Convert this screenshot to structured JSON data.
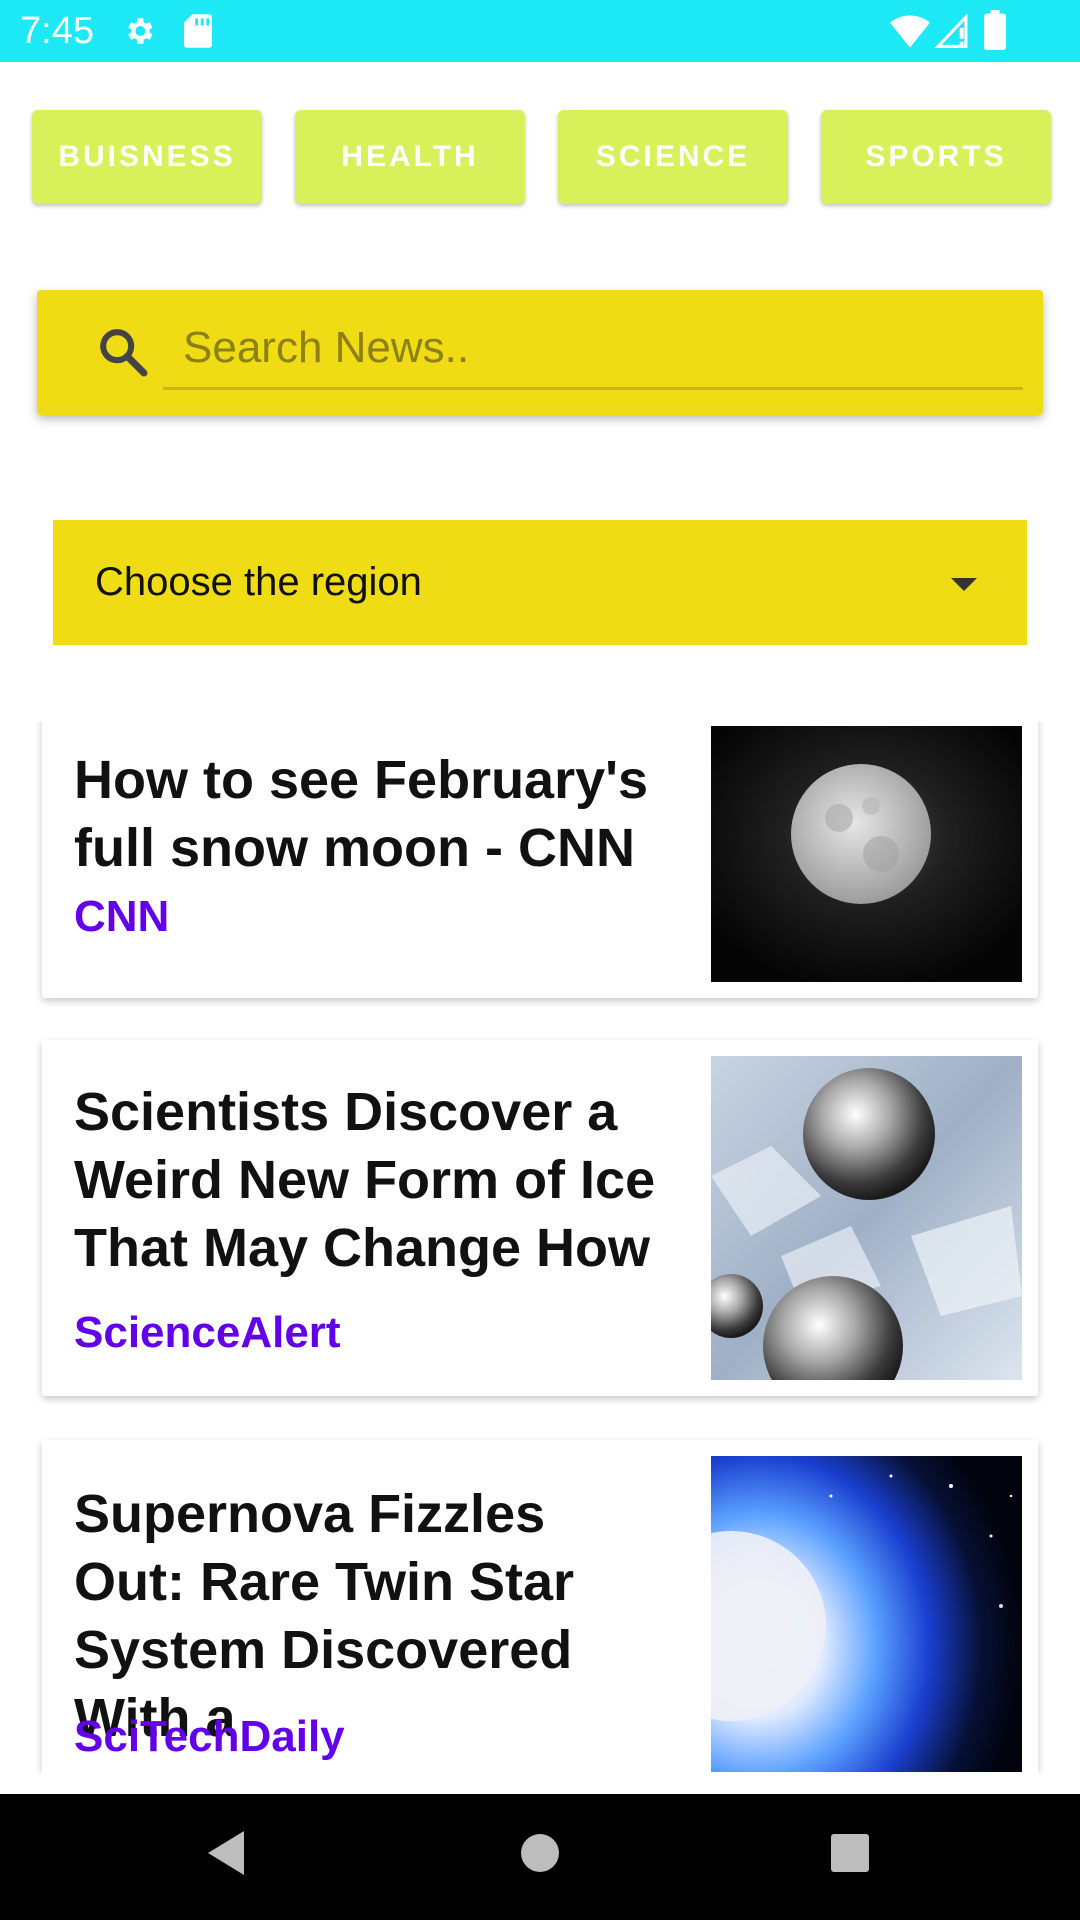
{
  "status_bar": {
    "time": "7:45",
    "icons": [
      "settings-icon",
      "sd-card-icon",
      "wifi-icon",
      "signal-icon",
      "battery-icon"
    ]
  },
  "categories": [
    {
      "label": "BUISNESS"
    },
    {
      "label": "HEALTH"
    },
    {
      "label": "SCIENCE"
    },
    {
      "label": "SPORTS"
    }
  ],
  "search": {
    "placeholder": "Search News..",
    "value": ""
  },
  "region": {
    "selected": "Choose the region"
  },
  "articles": [
    {
      "title": "How to see February's full snow moon - CNN",
      "source": "CNN",
      "image": "full-moon-photo"
    },
    {
      "title": "Scientists Discover a Weird New Form of Ice That May Change How",
      "source": "ScienceAlert",
      "image": "metal-spheres-in-ice-photo"
    },
    {
      "title": "Supernova Fizzles Out: Rare Twin Star System Discovered With a",
      "source": "SciTechDaily",
      "image": "blue-star-illustration"
    }
  ],
  "colors": {
    "status_bar": "#1de9f6",
    "category_button": "#d8f05a",
    "search_background": "#efdc14",
    "source_text": "#6200ea",
    "nav_bar": "#000000"
  },
  "nav": {
    "buttons": [
      "back-button",
      "home-button",
      "recents-button"
    ]
  }
}
